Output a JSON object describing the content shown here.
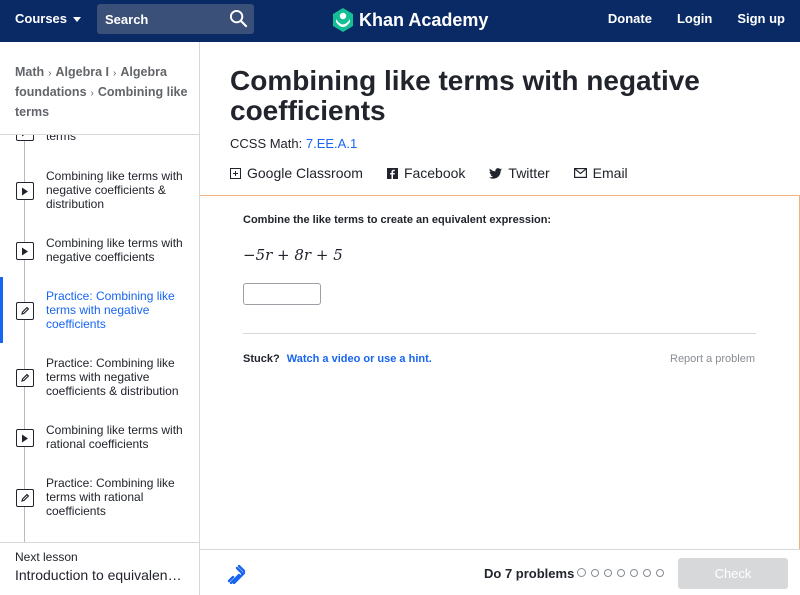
{
  "topbar": {
    "courses_label": "Courses",
    "search_placeholder": "Search",
    "brand": "Khan Academy",
    "nav": {
      "donate": "Donate",
      "login": "Login",
      "signup": "Sign up"
    }
  },
  "sidebar": {
    "breadcrumb": [
      "Math",
      "Algebra I",
      "Algebra foundations",
      "Combining like terms"
    ],
    "lessons": [
      {
        "label": "terms",
        "type": "video"
      },
      {
        "label": "Combining like terms with negative coefficients & distribution",
        "type": "video"
      },
      {
        "label": "Combining like terms with negative coefficients",
        "type": "video"
      },
      {
        "label": "Practice: Combining like terms with negative coefficients",
        "type": "practice",
        "active": true
      },
      {
        "label": "Practice: Combining like terms with negative coefficients & distribution",
        "type": "practice"
      },
      {
        "label": "Combining like terms with rational coefficients",
        "type": "video"
      },
      {
        "label": "Practice: Combining like terms with rational coefficients",
        "type": "practice"
      }
    ],
    "next_label": "Next lesson",
    "next_title": "Introduction to equivalent …"
  },
  "main": {
    "title": "Combining like terms with negative coefficients",
    "ccss_prefix": "CCSS Math:",
    "ccss_code": "7.EE.A.1",
    "share": {
      "google": "Google Classroom",
      "facebook": "Facebook",
      "twitter": "Twitter",
      "email": "Email"
    },
    "exercise": {
      "prompt": "Combine the like terms to create an equivalent expression:",
      "expression": "−5r + 8r + 5",
      "answer_value": "",
      "stuck_label": "Stuck?",
      "hint_link": "Watch a video or use a hint.",
      "report": "Report a problem"
    },
    "footer": {
      "do_problems": "Do 7 problems",
      "problem_count": 7,
      "check_label": "Check"
    }
  },
  "colors": {
    "topbar": "#0a2a66",
    "link": "#1865f2",
    "exercise_border": "#f0b27a",
    "check_disabled": "#d6d8da"
  }
}
